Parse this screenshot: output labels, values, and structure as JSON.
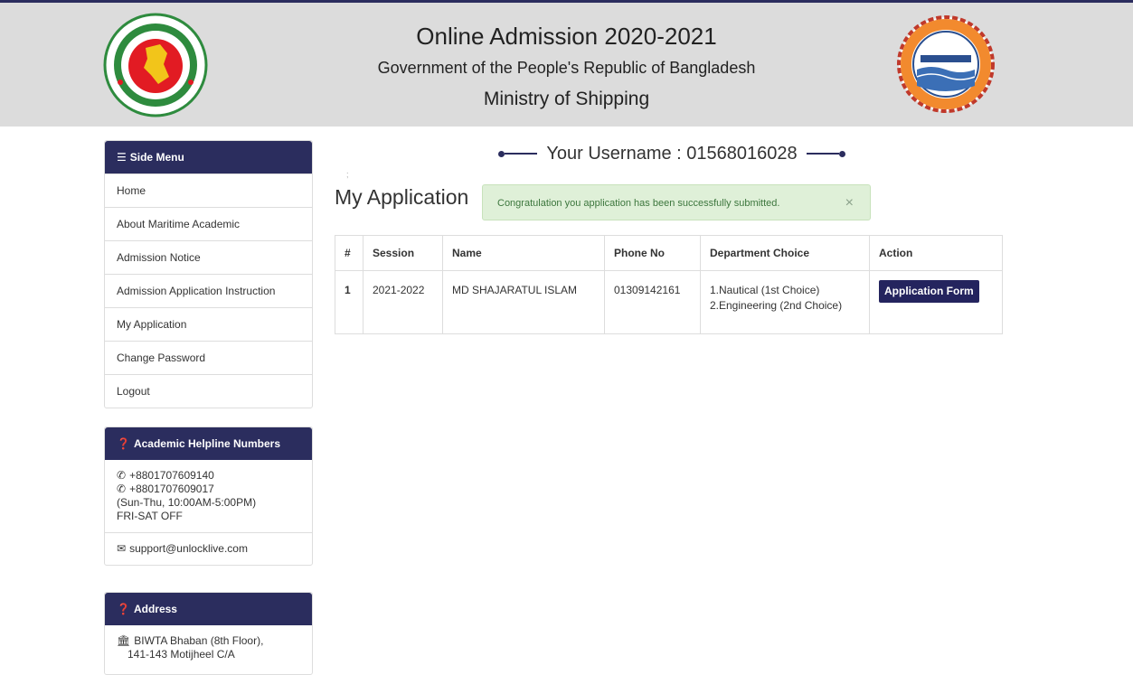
{
  "header": {
    "title": "Online Admission 2020-2021",
    "subtitle": "Government of the People's Republic of Bangladesh",
    "ministry": "Ministry of Shipping"
  },
  "username_label": "Your Username : 01568016028",
  "side_menu": {
    "title": "Side Menu",
    "items": [
      {
        "label": "Home"
      },
      {
        "label": "About Maritime Academic"
      },
      {
        "label": "Admission Notice"
      },
      {
        "label": "Admission Application Instruction"
      },
      {
        "label": "My Application"
      },
      {
        "label": "Change Password"
      },
      {
        "label": "Logout"
      }
    ]
  },
  "helpline": {
    "title": "Academic Helpline Numbers",
    "phone1": "+8801707609140",
    "phone2": "+8801707609017",
    "hours": "(Sun-Thu, 10:00AM-5:00PM)",
    "off": "FRI-SAT OFF",
    "email": "support@unlocklive.com"
  },
  "address": {
    "title": "Address",
    "line1": "BIWTA Bhaban (8th Floor),",
    "line2": "141-143 Motijheel C/A"
  },
  "main": {
    "stray_mark": ";",
    "title": "My Application",
    "alert": "Congratulation you application has been successfully submitted.",
    "alert_close": "×"
  },
  "table": {
    "headers": [
      "#",
      "Session",
      "Name",
      "Phone No",
      "Department Choice",
      "Action"
    ],
    "rows": [
      {
        "num": "1",
        "session": "2021-2022",
        "name": "MD SHAJARATUL ISLAM",
        "phone": "01309142161",
        "choice1": "1.Nautical (1st Choice)",
        "choice2": "2.Engineering (2nd Choice)",
        "action": "Application Form"
      }
    ]
  },
  "colors": {
    "primary": "#2b2d5e",
    "header_bg": "#dcdcdc",
    "alert_bg": "#dff0d8",
    "alert_text": "#3c763d"
  },
  "icons": {
    "menu": "bars-icon",
    "help": "question-circle-icon",
    "phone": "phone-icon",
    "email": "envelope-icon",
    "address": "bank-icon"
  }
}
